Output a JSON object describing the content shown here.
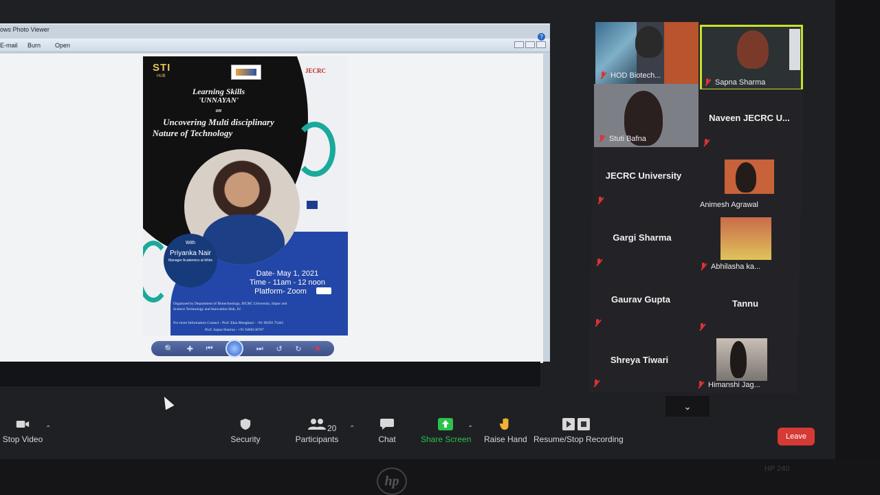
{
  "viewer": {
    "title": "ows Photo Viewer",
    "menu": [
      "E-mail",
      "Burn",
      "Open"
    ],
    "help_glyph": "?"
  },
  "poster": {
    "logo_left": "STI",
    "logo_left_sub": "HUB",
    "logo_right": "JECRC",
    "line1": "Learning Skills",
    "line2": "'UNNAYAN'",
    "line3": "on",
    "line4": "Uncovering Multi disciplinary",
    "line5": "Nature of Technology",
    "with": "With",
    "speaker": "Priyanka Nair",
    "speaker_role": "Manager Academics at Ikhtis",
    "date": "Date- May 1, 2021",
    "time": "Time - 11am - 12 noon",
    "platform": "Platform- Zoom",
    "organized_1": "Organized by Department of Biotechnology, JECRC University, Jaipur and",
    "organized_2": "Science Technology and Innovation Hub, JU",
    "contact_1": "For more Information Contact - Prof. Ekta Menghani - +91 98292 75441",
    "contact_2": "Prof. Sapna Sharma - +91 9460136707"
  },
  "participants": [
    {
      "name": "HOD Biotech...",
      "video": true
    },
    {
      "name": "Sapna Sharma",
      "video": true,
      "active": true
    },
    {
      "name": "Stuti Bafna",
      "video": true
    },
    {
      "name": "Naveen JECRC U...",
      "video": false
    },
    {
      "name": "JECRC University",
      "video": false
    },
    {
      "name": "Animesh Agrawal",
      "video": true
    },
    {
      "name": "Gargi Sharma",
      "video": false
    },
    {
      "name": "Abhilasha ka...",
      "video": true
    },
    {
      "name": "Gaurav Gupta",
      "video": false
    },
    {
      "name": "Tannu",
      "video": false
    },
    {
      "name": "Shreya Tiwari",
      "video": false
    },
    {
      "name": "Himanshi Jag...",
      "video": true
    }
  ],
  "toolbar": {
    "stop_video": "Stop Video",
    "security": "Security",
    "participants": "Participants",
    "participants_count": "20",
    "chat": "Chat",
    "share_screen": "Share Screen",
    "raise_hand": "Raise Hand",
    "record": "Resume/Stop Recording",
    "leave": "Leave"
  },
  "device": {
    "brand": "hp",
    "model": "HP 240"
  },
  "colors": {
    "accent_green": "#2bc24c",
    "leave_red": "#d63a34",
    "active_speaker": "#c8e22a"
  }
}
